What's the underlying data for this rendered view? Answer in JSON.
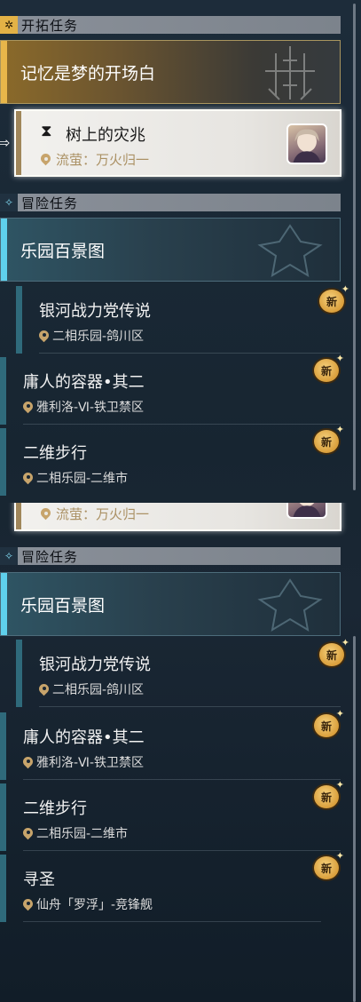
{
  "top_panel": {
    "trailblaze_section": {
      "title": "开拓任务",
      "icon": "star-diamond-icon"
    },
    "main_mission": {
      "label": "记忆是梦的开场白",
      "accent": "#e8b64a"
    },
    "selected_quest": {
      "title": "树上的灾兆",
      "location": "流萤：万火归一",
      "icon": "hourglass-icon"
    },
    "adventure_section": {
      "title": "冒险任务",
      "icon": "sparkle-icon"
    },
    "adventure_main": {
      "label": "乐园百景图",
      "accent": "#5fd0ec"
    },
    "adventure_items": [
      {
        "name": "银河战力党传说",
        "location": "二相乐园-鸽川区",
        "badge": "新"
      },
      {
        "name": "庸人的容器•其二",
        "location": "雅利洛-Ⅵ-铁卫禁区",
        "badge": "新"
      },
      {
        "name": "二维步行",
        "location": "二相乐园-二维市",
        "badge": "新"
      }
    ]
  },
  "bottom_panel": {
    "selected_quest_location": "流萤：万火归一",
    "adventure_section": {
      "title": "冒险任务",
      "icon": "sparkle-icon"
    },
    "adventure_main": {
      "label": "乐园百景图",
      "accent": "#5fd0ec"
    },
    "adventure_items": [
      {
        "name": "银河战力党传说",
        "location": "二相乐园-鸽川区",
        "badge": "新"
      },
      {
        "name": "庸人的容器•其二",
        "location": "雅利洛-Ⅵ-铁卫禁区",
        "badge": "新"
      },
      {
        "name": "二维步行",
        "location": "二相乐园-二维市",
        "badge": "新"
      },
      {
        "name": "寻圣",
        "location": "仙舟「罗浮」-竞锋舰",
        "badge": "新"
      }
    ]
  }
}
